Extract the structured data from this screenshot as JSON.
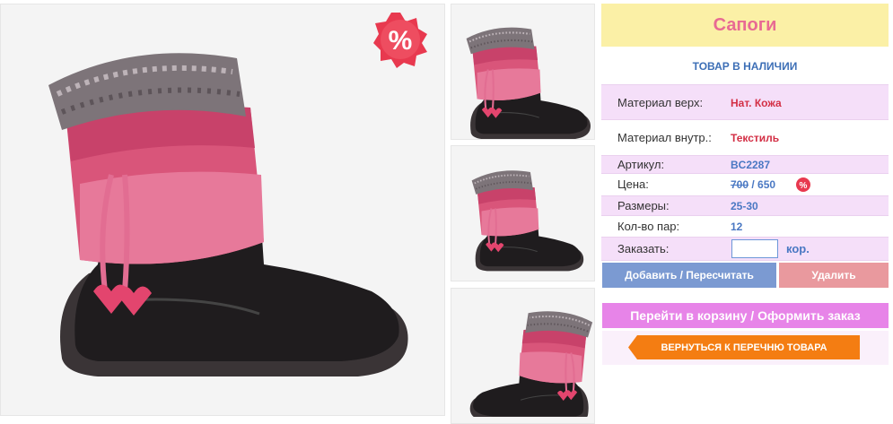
{
  "product": {
    "title": "Сапоги",
    "stock_status": "ТОВАР В НАЛИЧИИ",
    "sale_badge": "%",
    "specs": {
      "material_upper_label": "Материал верх:",
      "material_upper_value": "Нат. Кожа",
      "material_inner_label": "Материал внутр.:",
      "material_inner_value": "Текстиль",
      "article_label": "Артикул:",
      "article_value": "BC2287",
      "price_label": "Цена:",
      "price_old": "700",
      "price_sep": " / ",
      "price_new": "650",
      "sizes_label": "Размеры:",
      "sizes_value": "25-30",
      "pairs_label": "Кол-во пар:",
      "pairs_value": "12",
      "order_label": "Заказать:",
      "order_value": "",
      "order_unit": "кор."
    }
  },
  "buttons": {
    "add": "Добавить / Пересчитать",
    "delete": "Удалить",
    "cart": "Перейти в корзину / Оформить заказ",
    "back": "ВЕРНУТЬСЯ К ПЕРЕЧНЮ ТОВАРА"
  },
  "colors": {
    "title_bg": "#fbf0a6",
    "title_text": "#e86a93",
    "accent_blue": "#4a78c3",
    "accent_red": "#d32f45",
    "row_pink": "#f5dff9",
    "cart_button": "#e784e8",
    "back_button": "#f47d12"
  },
  "icons": {
    "sale": "percent-badge-icon",
    "back": "arrow-left-icon"
  }
}
